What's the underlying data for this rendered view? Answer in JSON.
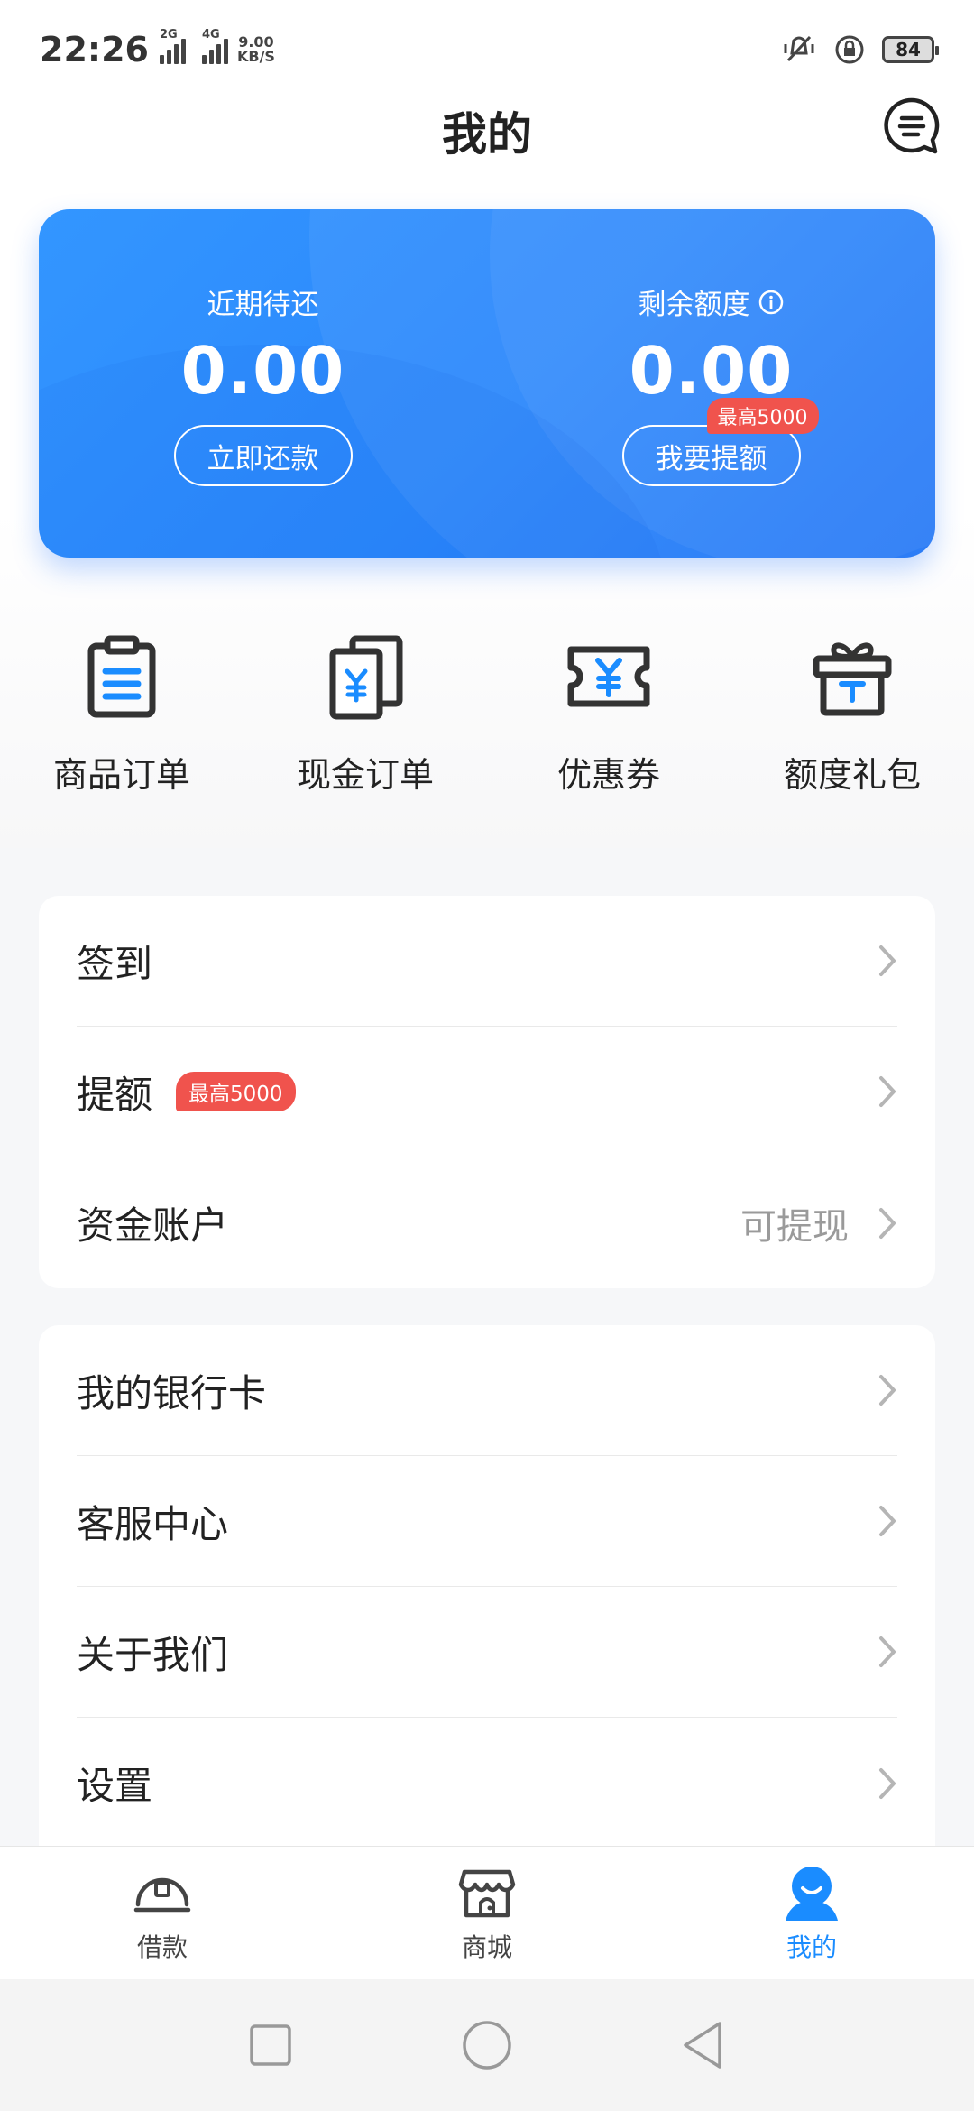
{
  "status_bar": {
    "time": "22:26",
    "net1": "2G",
    "net2": "4G",
    "speed_value": "9.00",
    "speed_unit": "KB/S",
    "battery": "84"
  },
  "header": {
    "title": "我的",
    "message_icon": "chat-bubble-icon"
  },
  "card": {
    "left_label": "近期待还",
    "left_amount": "0.00",
    "left_button": "立即还款",
    "right_label": "剩余额度",
    "right_amount": "0.00",
    "right_button": "我要提额",
    "right_badge": "最高5000",
    "accent_color": "#2b87fb"
  },
  "quick_entries": [
    {
      "label": "商品订单",
      "icon": "clipboard-icon"
    },
    {
      "label": "现金订单",
      "icon": "cash-docs-icon"
    },
    {
      "label": "优惠券",
      "icon": "coupon-icon"
    },
    {
      "label": "额度礼包",
      "icon": "gift-icon"
    }
  ],
  "menu_group1": [
    {
      "label": "签到",
      "badge": "",
      "extra": ""
    },
    {
      "label": "提额",
      "badge": "最高5000",
      "extra": ""
    },
    {
      "label": "资金账户",
      "badge": "",
      "extra": "可提现"
    }
  ],
  "menu_group2": [
    {
      "label": "我的银行卡"
    },
    {
      "label": "客服中心"
    },
    {
      "label": "关于我们"
    },
    {
      "label": "设置"
    }
  ],
  "bottom_nav": [
    {
      "label": "借款",
      "icon": "loan-icon",
      "active": false
    },
    {
      "label": "商城",
      "icon": "store-icon",
      "active": false
    },
    {
      "label": "我的",
      "icon": "profile-icon",
      "active": true
    }
  ],
  "colors": {
    "badge": "#f0534d",
    "active_nav": "#1a8cff"
  }
}
